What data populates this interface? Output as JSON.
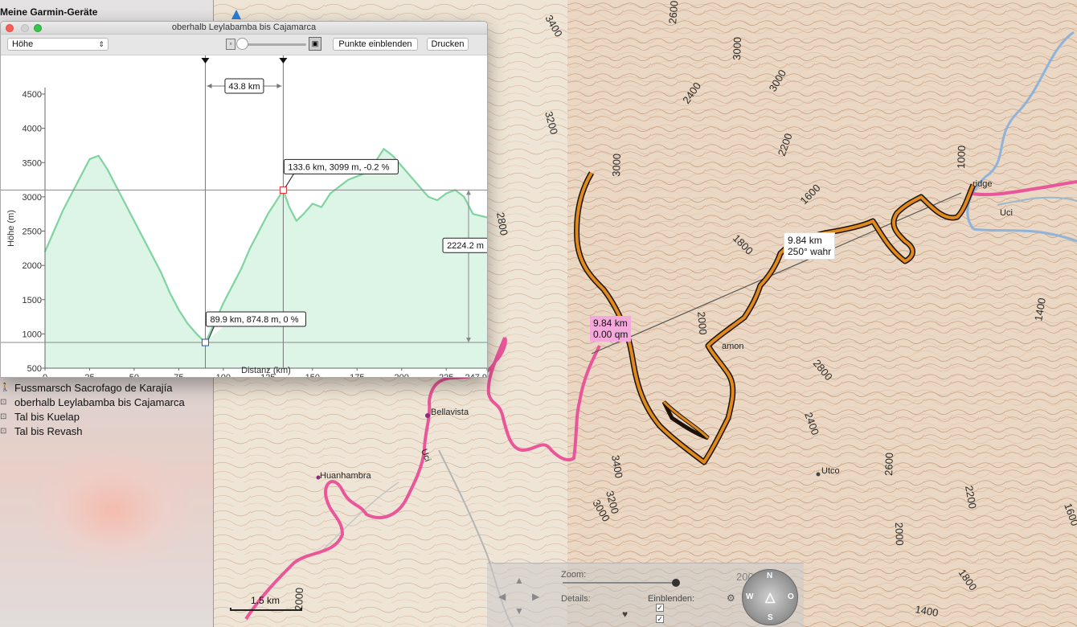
{
  "sidebar": {
    "header": "Meine Garmin-Geräte",
    "items": [
      {
        "label": "Fussmarsch Sacrofago de Karajía",
        "icon": "walking-icon"
      },
      {
        "label": "oberhalb Leylabamba bis Cajamarca",
        "icon": "track-icon"
      },
      {
        "label": "Tal bis Kuelap",
        "icon": "track-icon"
      },
      {
        "label": "Tal bis Revash",
        "icon": "track-icon"
      }
    ]
  },
  "window": {
    "title": "oberhalb Leylabamba bis Cajamarca",
    "profile_select": "Höhe",
    "buttons": {
      "show_points": "Punkte einblenden",
      "print": "Drucken"
    }
  },
  "chart_data": {
    "type": "area",
    "xlabel": "Distanz (km)",
    "ylabel": "Höhe (m)",
    "xlim": [
      0,
      247.9
    ],
    "ylim": [
      500,
      4500
    ],
    "xticks": [
      "0",
      "25",
      "50",
      "75",
      "100",
      "125",
      "150",
      "175",
      "200",
      "225",
      "247.9"
    ],
    "yticks": [
      "500",
      "1000",
      "1500",
      "2000",
      "2500",
      "3000",
      "3500",
      "4000",
      "4500"
    ],
    "x": [
      0,
      5,
      10,
      15,
      20,
      25,
      30,
      35,
      40,
      45,
      50,
      55,
      60,
      65,
      70,
      75,
      80,
      85,
      89.9,
      95,
      100,
      105,
      110,
      115,
      120,
      125,
      130,
      133.6,
      137,
      141,
      145,
      150,
      155,
      160,
      165,
      170,
      175,
      180,
      185,
      190,
      195,
      200,
      205,
      210,
      215,
      220,
      225,
      230,
      235,
      240,
      247.9
    ],
    "y": [
      2200,
      2500,
      2800,
      3050,
      3300,
      3550,
      3600,
      3400,
      3150,
      2900,
      2650,
      2400,
      2150,
      1900,
      1600,
      1350,
      1150,
      1000,
      874.8,
      1150,
      1450,
      1700,
      1950,
      2250,
      2500,
      2750,
      2950,
      3099,
      2850,
      2650,
      2750,
      2900,
      2850,
      3050,
      3150,
      3250,
      3300,
      3350,
      3500,
      3700,
      3600,
      3450,
      3300,
      3150,
      3000,
      2950,
      3050,
      3100,
      3000,
      2750,
      2700
    ],
    "fill_color": "#dcf5e6",
    "line_color": "#7fd4a0",
    "markers": [
      {
        "x": 89.9,
        "label": "89.9 km, 874.8 m, 0 %",
        "color": "#2b4bd6"
      },
      {
        "x": 133.6,
        "label": "133.6 km, 3099 m, -0.2 %",
        "color": "#e03030"
      }
    ],
    "span_label": "43.8 km",
    "rise_label": "2224.2 m"
  },
  "map": {
    "callout_pink": [
      "9.84 km",
      "0.00 qm"
    ],
    "callout_white": [
      "9.84 km",
      "250° wahr"
    ],
    "scale": "1.5 km",
    "places": [
      "Bellavista",
      "Huanhambra",
      "Utco",
      "Uci",
      "Uci",
      "ridge",
      "amon"
    ],
    "elevations": [
      "3400",
      "2600",
      "3000",
      "3000",
      "2400",
      "3200",
      "2200",
      "3000",
      "1000",
      "1600",
      "2800",
      "1800",
      "2000",
      "2800",
      "2400",
      "3400",
      "2600",
      "3200",
      "3000",
      "2200",
      "1400",
      "2000",
      "1600",
      "1800",
      "1400",
      "2000",
      "2000"
    ],
    "track_color": "#e08a1e",
    "route_color": "#e9579a"
  },
  "controls": {
    "zoom_label": "Zoom:",
    "details_label": "Details:",
    "einblenden_label": "Einblenden:",
    "check_mark": "✓",
    "compass": {
      "n": "N",
      "s": "S",
      "w": "W",
      "o": "O"
    }
  }
}
